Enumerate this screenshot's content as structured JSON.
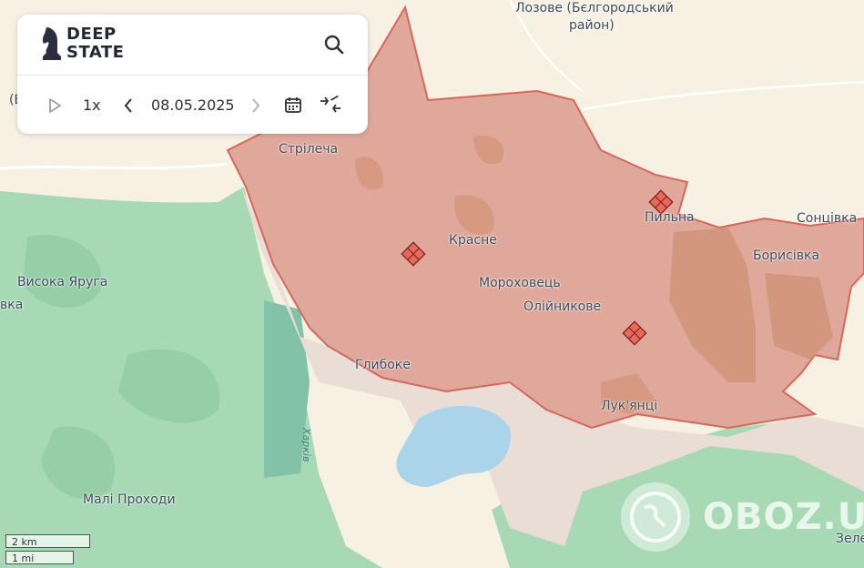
{
  "map": {
    "places": [
      {
        "id": "stril",
        "name": "Стрілеча"
      },
      {
        "id": "krasne",
        "name": "Красне"
      },
      {
        "id": "pylna",
        "name": "Пильна"
      },
      {
        "id": "sontsivka",
        "name": "Сонцівка"
      },
      {
        "id": "borysivka",
        "name": "Борисівка"
      },
      {
        "id": "vysoka",
        "name": "Висока Яруга"
      },
      {
        "id": "morokhovets",
        "name": "Мороховець"
      },
      {
        "id": "oliinykove",
        "name": "Олійникове"
      },
      {
        "id": "hlyboke",
        "name": "Глибоке"
      },
      {
        "id": "lukiantsi",
        "name": "Лук'янці"
      },
      {
        "id": "mali",
        "name": "Малі Проходи"
      },
      {
        "id": "lozove1",
        "name": "Лозове (Бєлгородський"
      },
      {
        "id": "lozove2",
        "name": "район)"
      },
      {
        "id": "edge_vka",
        "name": "вка"
      },
      {
        "id": "edge_zele",
        "name": "Зеле"
      },
      {
        "id": "edge_paren",
        "name": "(Б"
      }
    ],
    "river": "Харків",
    "colors": {
      "occupied": "#e0a89a",
      "occupied_border": "#d6675a",
      "gray_zone": "#eaddd6",
      "ukraine_green": "#a8d9b5",
      "russia_land": "#f7f1e3",
      "water": "#a9d4ea",
      "marker": "#e8685a"
    }
  },
  "panel": {
    "logo_line1": "DEEP",
    "logo_line2": "STATE",
    "logo_icon": "knight-chess-icon",
    "search_icon": "search-icon",
    "speed": "1x",
    "date": "08.05.2025",
    "play_icon": "play-icon",
    "prev_icon": "chevron-left-icon",
    "next_icon": "chevron-right-icon",
    "calendar_icon": "calendar-icon",
    "collapse_icon": "compress-arrows-icon"
  },
  "scale": {
    "km": "2 km",
    "mi": "1 mi"
  },
  "watermark": "OBOZ.UA"
}
